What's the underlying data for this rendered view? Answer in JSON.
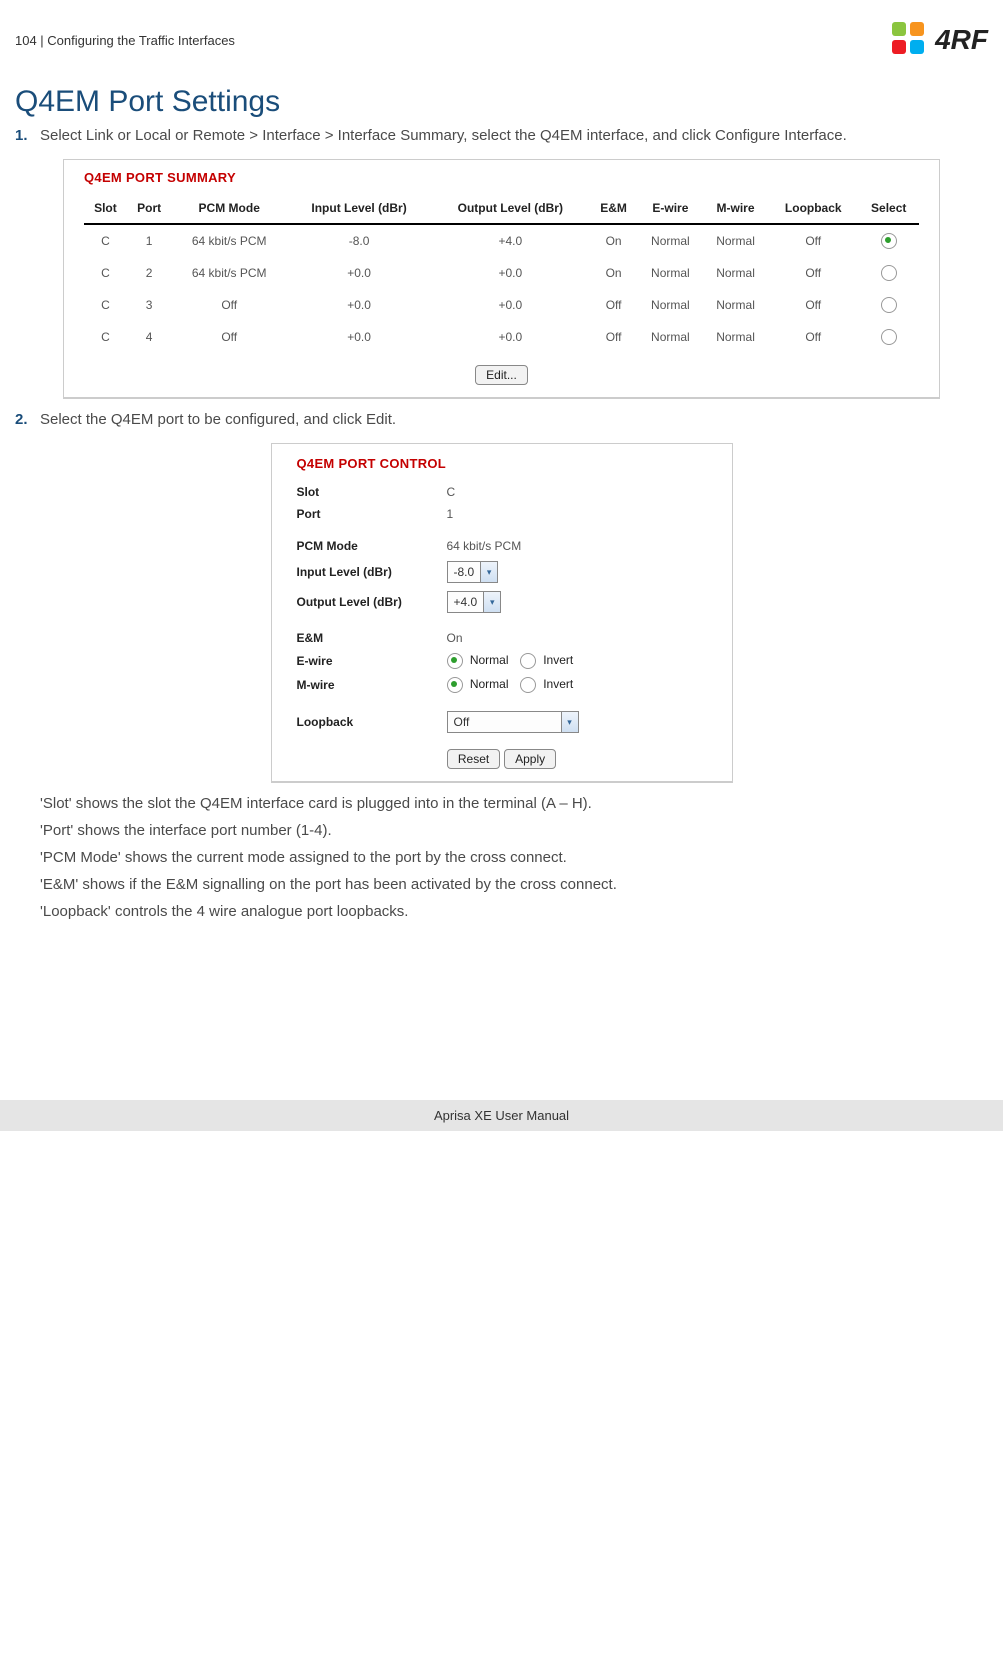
{
  "header": {
    "page_ref": "104  |  Configuring the Traffic Interfaces",
    "brand": "4RF"
  },
  "title": "Q4EM Port Settings",
  "steps": {
    "s1": "Select Link or Local or Remote > Interface > Interface Summary, select the Q4EM interface, and click Configure Interface.",
    "s2": "Select the Q4EM port to be configured, and click Edit."
  },
  "summary": {
    "panel_title": "Q4EM PORT SUMMARY",
    "cols": {
      "slot": "Slot",
      "port": "Port",
      "pcm": "PCM Mode",
      "in": "Input Level (dBr)",
      "out": "Output Level (dBr)",
      "em": "E&M",
      "ew": "E-wire",
      "mw": "M-wire",
      "lb": "Loopback",
      "sel": "Select"
    },
    "rows": [
      {
        "slot": "C",
        "port": "1",
        "pcm": "64 kbit/s PCM",
        "in": "-8.0",
        "out": "+4.0",
        "em": "On",
        "ew": "Normal",
        "mw": "Normal",
        "lb": "Off",
        "sel": true
      },
      {
        "slot": "C",
        "port": "2",
        "pcm": "64 kbit/s PCM",
        "in": "+0.0",
        "out": "+0.0",
        "em": "On",
        "ew": "Normal",
        "mw": "Normal",
        "lb": "Off",
        "sel": false
      },
      {
        "slot": "C",
        "port": "3",
        "pcm": "Off",
        "in": "+0.0",
        "out": "+0.0",
        "em": "Off",
        "ew": "Normal",
        "mw": "Normal",
        "lb": "Off",
        "sel": false
      },
      {
        "slot": "C",
        "port": "4",
        "pcm": "Off",
        "in": "+0.0",
        "out": "+0.0",
        "em": "Off",
        "ew": "Normal",
        "mw": "Normal",
        "lb": "Off",
        "sel": false
      }
    ],
    "edit_btn": "Edit..."
  },
  "control": {
    "panel_title": "Q4EM PORT CONTROL",
    "labels": {
      "slot": "Slot",
      "port": "Port",
      "pcm": "PCM Mode",
      "in": "Input Level (dBr)",
      "out": "Output Level (dBr)",
      "em": "E&M",
      "ew": "E-wire",
      "mw": "M-wire",
      "lb": "Loopback"
    },
    "values": {
      "slot": "C",
      "port": "1",
      "pcm": "64 kbit/s PCM",
      "in": "-8.0",
      "out": "+4.0",
      "em": "On",
      "lb": "Off"
    },
    "radio": {
      "normal": "Normal",
      "invert": "Invert"
    },
    "buttons": {
      "reset": "Reset",
      "apply": "Apply"
    }
  },
  "paras": {
    "p1": "'Slot' shows the slot the Q4EM interface card is plugged into in the terminal (A – H).",
    "p2": "'Port' shows the interface port number (1-4).",
    "p3": "'PCM Mode' shows the current mode assigned to the port by the cross connect.",
    "p4": "'E&M' shows if the E&M signalling on the port has been activated by the cross connect.",
    "p5": "'Loopback' controls the 4 wire analogue port loopbacks."
  },
  "footer": "Aprisa XE User Manual"
}
